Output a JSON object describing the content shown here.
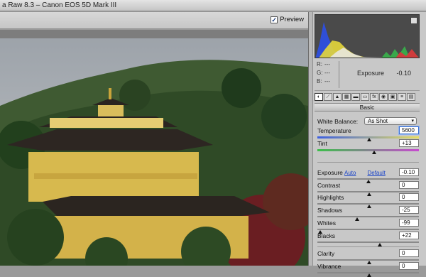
{
  "window": {
    "title": "a Raw 8.3  –  Canon EOS 5D Mark III"
  },
  "toolbar": {
    "preview_label": "Preview",
    "preview_checked": "✓"
  },
  "histogram": {
    "readout": {
      "r": "R:",
      "g": "G:",
      "b": "B:",
      "dash": "---"
    },
    "exposure_label": "Exposure",
    "exposure_value": "-0.10"
  },
  "panel": {
    "tabs": [
      "◐",
      "⟋",
      "▲",
      "▦",
      "▬",
      "▭",
      "fx",
      "◉",
      "▣",
      "≡",
      "▤"
    ],
    "section_title": "Basic",
    "white_balance": {
      "label": "White Balance:",
      "value": "As Shot"
    },
    "auto_label": "Auto",
    "default_label": "Default",
    "sliders": [
      {
        "key": "temperature",
        "label": "Temperature",
        "value": "5600",
        "level": 0.5
      },
      {
        "key": "tint",
        "label": "Tint",
        "value": "+13",
        "level": 0.55
      },
      {
        "key": "exposure",
        "label": "Exposure",
        "value": "-0.10",
        "level": 0.49
      },
      {
        "key": "contrast",
        "label": "Contrast",
        "value": "0",
        "level": 0.5
      },
      {
        "key": "highlights",
        "label": "Highlights",
        "value": "0",
        "level": 0.5
      },
      {
        "key": "shadows",
        "label": "Shadows",
        "value": "-25",
        "level": 0.375
      },
      {
        "key": "whites",
        "label": "Whites",
        "value": "-99",
        "level": 0.005
      },
      {
        "key": "blacks",
        "label": "Blacks",
        "value": "+22",
        "level": 0.61
      },
      {
        "key": "clarity",
        "label": "Clarity",
        "value": "0",
        "level": 0.5
      },
      {
        "key": "vibrance",
        "label": "Vibrance",
        "value": "0",
        "level": 0.5
      }
    ]
  }
}
